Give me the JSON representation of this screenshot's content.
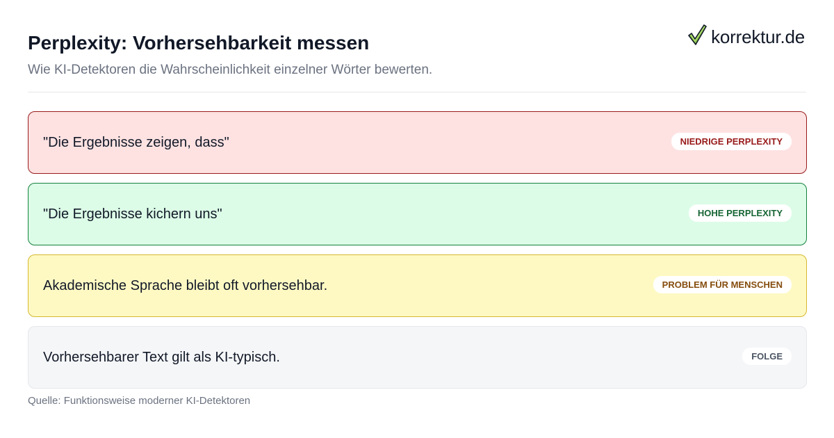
{
  "header": {
    "title": "Perplexity: Vorhersehbarkeit messen",
    "subtitle": "Wie KI-Detektoren die Wahrscheinlichkeit einzelner Wörter bewerten."
  },
  "logo": {
    "text": "korrektur.de",
    "icon": "checkmark-icon",
    "icon_color": "#8BC34A"
  },
  "cards": [
    {
      "text": "\"Die Ergebnisse zeigen, dass\"",
      "badge": "NIEDRIGE PERPLEXITY",
      "accent": "#991b1b"
    },
    {
      "text": "\"Die Ergebnisse kichern uns\"",
      "badge": "HOHE PERPLEXITY",
      "accent": "#166534"
    },
    {
      "text": "Akademische Sprache bleibt oft vorhersehbar.",
      "badge": "PROBLEM FÜR MENSCHEN",
      "accent": "#854d0e"
    },
    {
      "text": "Vorhersehbarer Text gilt als KI-typisch.",
      "badge": "FOLGE",
      "accent": "#4b5563"
    }
  ],
  "source": "Quelle: Funktionsweise moderner KI-Detektoren"
}
